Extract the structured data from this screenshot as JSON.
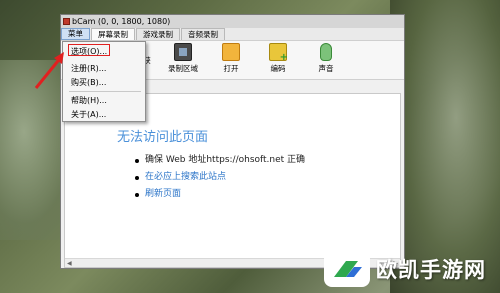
{
  "window": {
    "title": "bCam (0, 0, 1800, 1080)"
  },
  "menubar": {
    "items": [
      "菜单",
      "屏幕录制",
      "游戏录制",
      "音频录制"
    ]
  },
  "toolbar": {
    "partial_label": "获",
    "region_label": "录制区域",
    "open_label": "打开",
    "encode_label": "编码",
    "sound_label": "声音"
  },
  "dropdown": {
    "options": "选项(O)...",
    "register": "注册(R)...",
    "buy": "购买(B)...",
    "help": "帮助(H)...",
    "about": "关于(A)..."
  },
  "content": {
    "error_title": "无法访问此页面",
    "bullet1": "确保 Web 地址https://ohsoft.net 正确",
    "bullet2": "在必应上搜索此站点",
    "bullet3": "刷新页面"
  },
  "watermark": {
    "text": "欧凯手游网"
  },
  "colors": {
    "accent": "#4a90d9",
    "link": "#2b74c8",
    "highlight": "#e02020"
  }
}
